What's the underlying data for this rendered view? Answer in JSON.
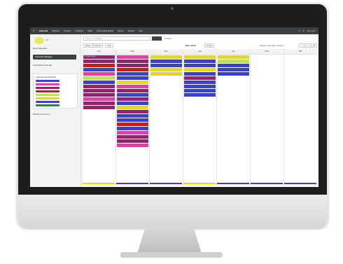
{
  "top_nav": {
    "items": [
      {
        "label": "Calendar",
        "active": true
      },
      {
        "label": "Projects",
        "active": false
      },
      {
        "label": "Groups",
        "active": false
      },
      {
        "label": "Contacts",
        "active": false
      },
      {
        "label": "Stats",
        "active": false
      },
      {
        "label": "Community Board",
        "active": false
      },
      {
        "label": "Forum",
        "active": false
      },
      {
        "label": "Tickets",
        "active": false
      },
      {
        "label": "Tool",
        "active": false
      }
    ],
    "user_label": "Keo Apro"
  },
  "sidebar": {
    "logo_text": "Obi",
    "heading": "New Calendars",
    "primary_button": "Calendar Manager",
    "links": [
      "Subscribed calendar",
      "Agenda and Calendar",
      "Weekly Document"
    ],
    "agenda_title": "Agenda and Calendar",
    "agenda_colors": [
      "#3a3fd1",
      "#e83aa8",
      "#9b1f6f",
      "#d61414",
      "#b9e54a",
      "#e5d81a",
      "#3a3fd1",
      "#1b8f2b"
    ]
  },
  "toolbar": {
    "search_placeholder": "Search in agenda...",
    "action_label": "Options",
    "view_buttons": [
      "Week",
      "Month",
      "Year"
    ],
    "period": "Mars 2016",
    "today_label": "Today",
    "right_label": "Display Calendar / Events"
  },
  "calendar": {
    "days": [
      "Lun",
      "Mar",
      "Mer",
      "Jeu",
      "Ven",
      "Sam",
      "Dim"
    ],
    "columns": [
      {
        "events": [
          {
            "label": "9h - Réunion prép.",
            "color": "#9b1f6f"
          },
          {
            "label": "",
            "color": "#9b1f6f"
          },
          {
            "label": "",
            "color": "#d61414"
          },
          {
            "label": "",
            "color": "#3a3fd1"
          },
          {
            "label": "",
            "color": "#e83aa8"
          },
          {
            "label": "",
            "color": "#b9e54a"
          },
          {
            "label": "",
            "color": "#3a3fd1"
          },
          {
            "label": "",
            "color": "#9b1f6f"
          },
          {
            "label": "",
            "color": "#9b1f6f"
          },
          {
            "label": "",
            "color": "#9b1f6f"
          },
          {
            "label": "",
            "color": "#e83aa8"
          },
          {
            "label": "",
            "color": "#9b1f6f"
          },
          {
            "label": "",
            "color": "#9b1f6f"
          }
        ]
      },
      {
        "events": [
          {
            "label": "",
            "color": "#e83aa8"
          },
          {
            "label": "",
            "color": "#9b1f6f"
          },
          {
            "label": "",
            "color": "#9b1f6f"
          },
          {
            "label": "",
            "color": "#d61414"
          },
          {
            "label": "",
            "color": "#3a3fd1"
          },
          {
            "label": "",
            "color": "#3a3fd1"
          },
          {
            "label": "",
            "color": "#e5d81a"
          },
          {
            "label": "",
            "color": "#e83aa8"
          },
          {
            "label": "",
            "color": "#9b1f6f"
          },
          {
            "label": "",
            "color": "#3a3fd1"
          },
          {
            "label": "",
            "color": "#9b1f6f"
          },
          {
            "label": "",
            "color": "#3a3fd1"
          },
          {
            "label": "",
            "color": "#e5d81a"
          },
          {
            "label": "",
            "color": "#9b1f6f"
          },
          {
            "label": "",
            "color": "#3a3fd1"
          },
          {
            "label": "",
            "color": "#3a3fd1"
          },
          {
            "label": "",
            "color": "#d61414"
          },
          {
            "label": "",
            "color": "#3a3fd1"
          },
          {
            "label": "",
            "color": "#e83aa8"
          },
          {
            "label": "",
            "color": "#9b1f6f"
          },
          {
            "label": "",
            "color": "#9b1f6f"
          },
          {
            "label": "",
            "color": "#e83aa8"
          }
        ]
      },
      {
        "events": [
          {
            "label": "",
            "color": "#e5d81a"
          },
          {
            "label": "",
            "color": "#3a3fd1"
          },
          {
            "label": "",
            "color": "#3a3fd1"
          },
          {
            "label": "",
            "color": "#e5d81a"
          },
          {
            "label": "",
            "color": "#e5d81a"
          }
        ]
      },
      {
        "events": [
          {
            "label": "",
            "color": "#e5d81a"
          },
          {
            "label": "",
            "color": "#3a3fd1"
          },
          {
            "label": "",
            "color": "#3a3fd1"
          },
          {
            "label": "",
            "color": "#e5d81a"
          },
          {
            "label": "",
            "color": "#3a3fd1"
          },
          {
            "label": "",
            "color": "#9b1f6f"
          },
          {
            "label": "",
            "color": "#3a3fd1"
          },
          {
            "label": "",
            "color": "#3a3fd1"
          },
          {
            "label": "",
            "color": "#3a3fd1"
          },
          {
            "label": "",
            "color": "#3a3fd1"
          }
        ]
      },
      {
        "events": [
          {
            "label": "",
            "color": "#e5d81a"
          },
          {
            "label": "",
            "color": "#b9e54a"
          },
          {
            "label": "",
            "color": "#3a3fd1"
          },
          {
            "label": "",
            "color": "#3a3fd1"
          },
          {
            "label": "",
            "color": "#3a3fd1"
          }
        ]
      },
      {
        "events": []
      },
      {
        "events": []
      }
    ],
    "bottom_colors": [
      "#e5d81a",
      "#3a3fd1",
      "#3a3fd1",
      "#e5d81a",
      "#3a3fd1",
      "#3a3fd1",
      "#3a3fd1"
    ]
  }
}
